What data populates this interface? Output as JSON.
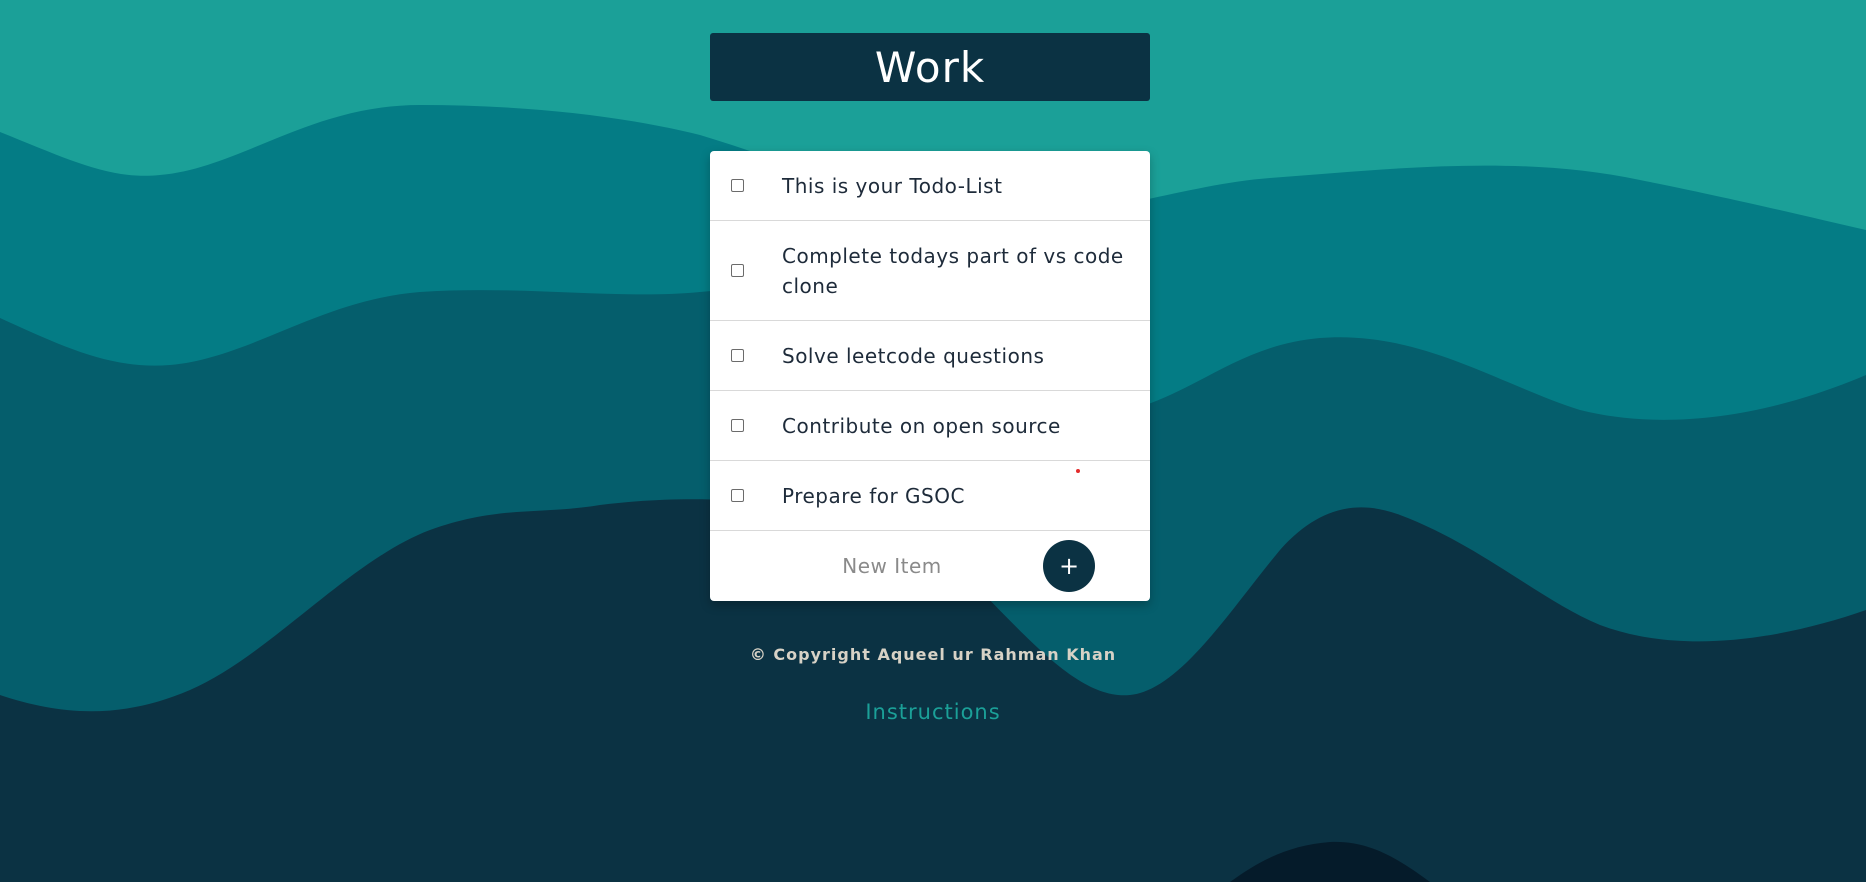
{
  "list": {
    "title": "Work",
    "items": [
      {
        "text": "This is your Todo-List",
        "checked": false
      },
      {
        "text": "Complete todays part of vs code clone",
        "checked": false
      },
      {
        "text": "Solve leetcode questions",
        "checked": false
      },
      {
        "text": "Contribute on open source",
        "checked": false
      },
      {
        "text": "Prepare for GSOC",
        "checked": false
      }
    ]
  },
  "new_item": {
    "placeholder": "New Item",
    "add_label": "+"
  },
  "footer": {
    "copyright": "© Copyright Aqueel ur Rahman Khan",
    "instructions_link": "Instructions"
  },
  "colors": {
    "heading_bg": "#0b3243",
    "accent": "#1ba098",
    "wave_1": "#1ba098",
    "wave_2": "#047c85",
    "wave_3": "#055e6c",
    "wave_4": "#0b3243",
    "wave_5": "#051b2a"
  }
}
